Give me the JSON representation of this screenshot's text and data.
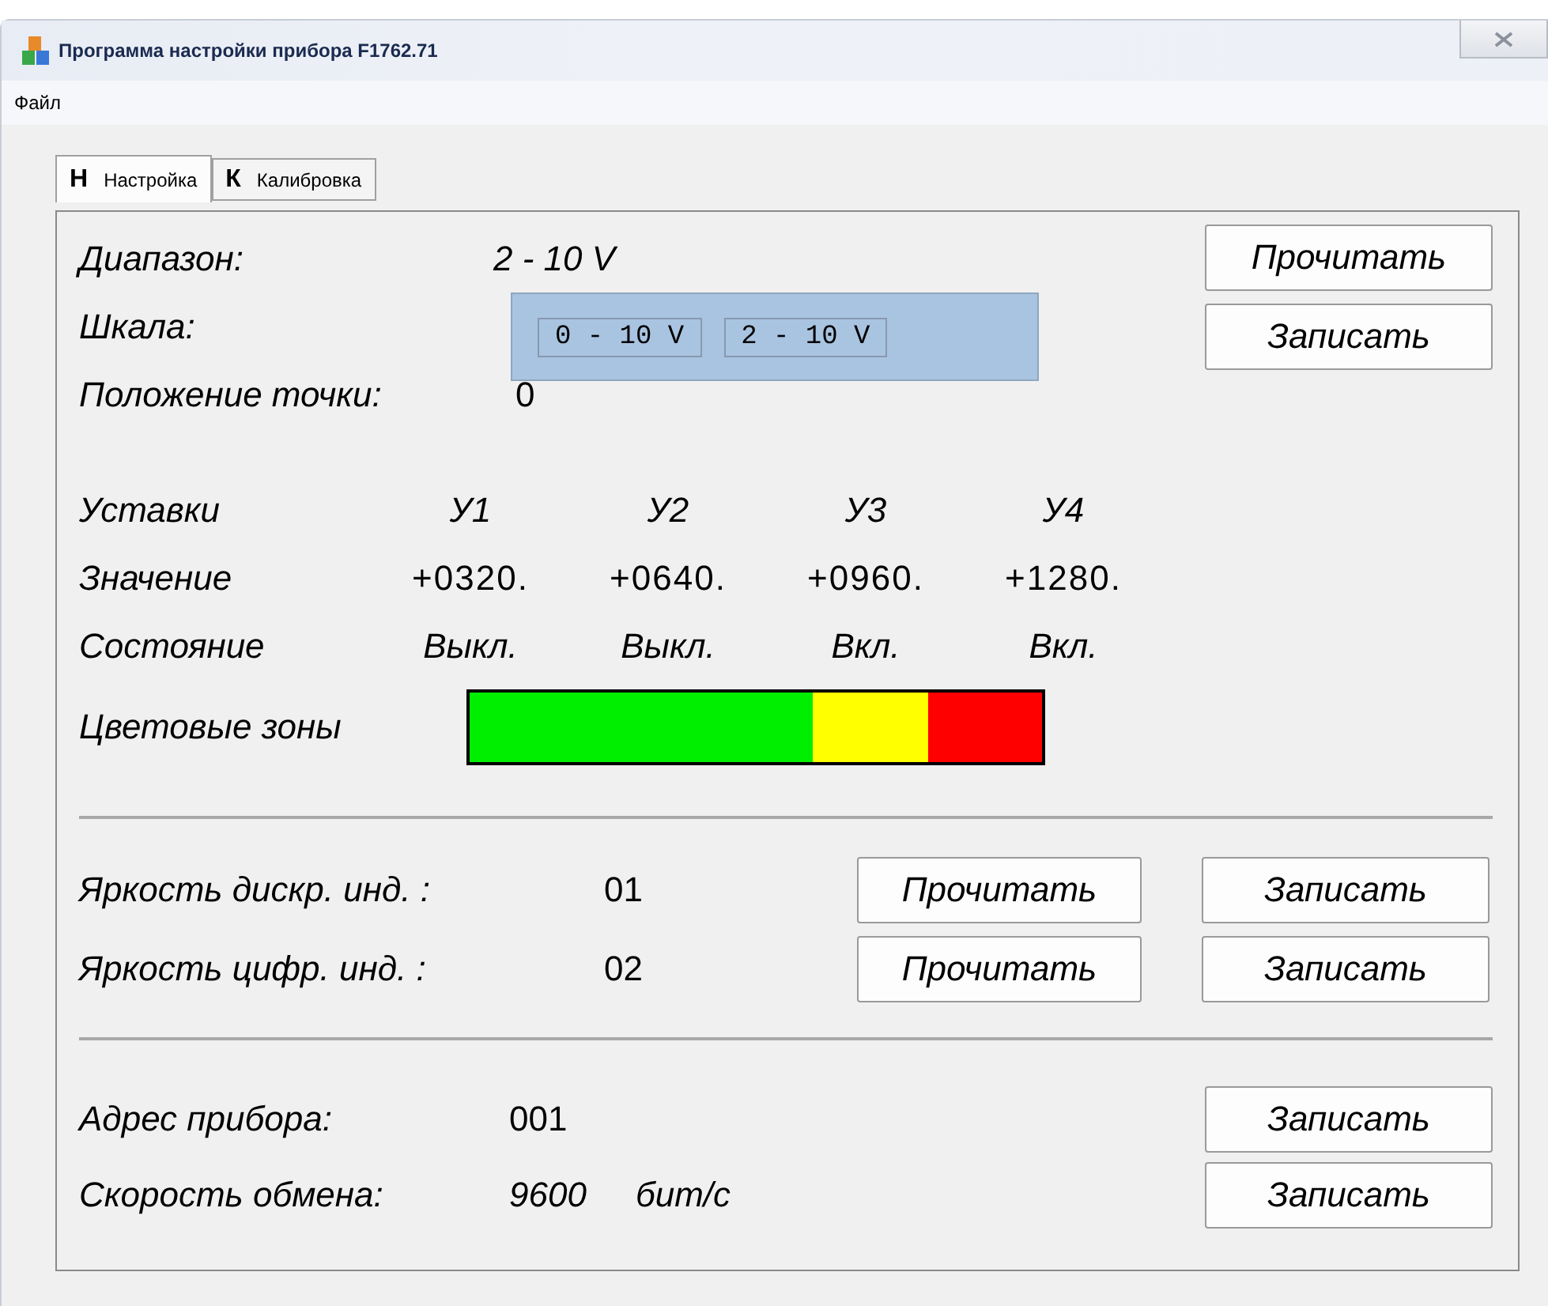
{
  "window": {
    "title": "Программа настройки прибора F1762.71"
  },
  "menu": [
    "Файл"
  ],
  "tabs": [
    {
      "letter": "Н",
      "label": "Настройка",
      "selected": true
    },
    {
      "letter": "К",
      "label": "Калибровка",
      "selected": false
    }
  ],
  "range": {
    "label": "Диапазон:",
    "value": "2 - 10 V"
  },
  "scale": {
    "label": "Шкала:",
    "options": [
      "0 - 10 V",
      "2 - 10 V"
    ]
  },
  "point": {
    "label": "Положение точки:",
    "value": "0"
  },
  "top_buttons": [
    "Прочитать",
    "Записать"
  ],
  "setpoints": {
    "header": "Уставки",
    "names": [
      "У1",
      "У2",
      "У3",
      "У4"
    ],
    "value_label": "Значение",
    "values": [
      "+0320.",
      "+0640.",
      "+0960.",
      "+1280."
    ],
    "state_label": "Состояние",
    "states": [
      "Выкл.",
      "Выкл.",
      "Вкл.",
      "Вкл."
    ]
  },
  "color_zones": {
    "label": "Цветовые зоны",
    "zones": [
      {
        "color": "#00ee00"
      },
      {
        "color": "#ffff00"
      },
      {
        "color": "#ff0000"
      }
    ]
  },
  "brightness": [
    {
      "label": "Яркость дискр. инд. :",
      "value": "01",
      "read": "Прочитать",
      "write": "Записать"
    },
    {
      "label": "Яркость цифр. инд. :",
      "value": "02",
      "read": "Прочитать",
      "write": "Записать"
    }
  ],
  "comm": [
    {
      "label": "Адрес прибора:",
      "value": "001",
      "write": "Записать"
    },
    {
      "label": "Скорость обмена:",
      "value": "9600",
      "unit": "бит/с",
      "write": "Записать"
    }
  ]
}
